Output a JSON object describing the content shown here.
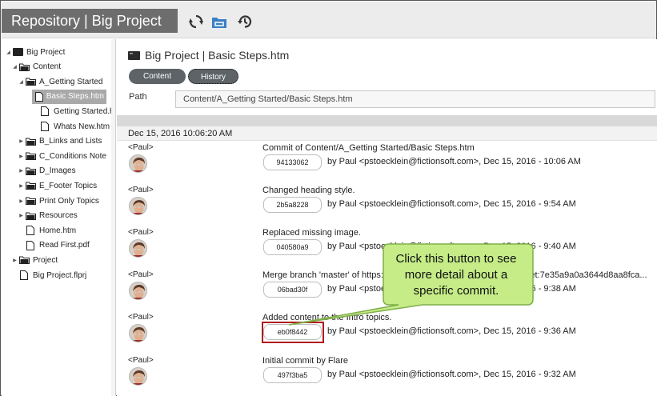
{
  "app": {
    "title": "Repository | Big Project"
  },
  "toolbar": {
    "icons": [
      "sync-icon",
      "folder-icon",
      "history-icon"
    ]
  },
  "sidebar": {
    "items": [
      {
        "label": "Big Project",
        "icon": "project-icon",
        "level": 0,
        "expanded": true
      },
      {
        "label": "Content",
        "icon": "folder-icon",
        "level": 1,
        "expanded": true
      },
      {
        "label": "A_Getting Started",
        "icon": "folder-icon",
        "level": 2,
        "expanded": true
      },
      {
        "label": "Basic Steps.htm",
        "icon": "file-icon",
        "level": 3,
        "selected": true
      },
      {
        "label": "Getting Started.h",
        "icon": "file-icon",
        "level": 3
      },
      {
        "label": "Whats New.htm",
        "icon": "file-icon",
        "level": 3
      },
      {
        "label": "B_Links and Lists",
        "icon": "folder-icon",
        "level": 2,
        "expanded": false
      },
      {
        "label": "C_Conditions Note",
        "icon": "folder-icon",
        "level": 2,
        "expanded": false
      },
      {
        "label": "D_Images",
        "icon": "folder-icon",
        "level": 2,
        "expanded": false
      },
      {
        "label": "E_Footer Topics",
        "icon": "folder-icon",
        "level": 2,
        "expanded": false
      },
      {
        "label": "Print Only Topics",
        "icon": "folder-icon",
        "level": 2,
        "expanded": false
      },
      {
        "label": "Resources",
        "icon": "folder-icon",
        "level": 2,
        "expanded": false
      },
      {
        "label": "Home.htm",
        "icon": "file-icon",
        "level": 2
      },
      {
        "label": "Read First.pdf",
        "icon": "file-icon",
        "level": 2
      },
      {
        "label": "Project",
        "icon": "folder-icon",
        "level": 1,
        "expanded": false
      },
      {
        "label": "Big Project.flprj",
        "icon": "file-icon",
        "level": 1
      }
    ]
  },
  "doc": {
    "header": "Big Project | Basic Steps.htm",
    "tabs": [
      {
        "label": "Content",
        "active": false
      },
      {
        "label": "History",
        "active": true
      }
    ],
    "path_label": "Path",
    "path_value": "Content/A_Getting Started/Basic Steps.htm"
  },
  "history": {
    "date": "Dec 15, 2016 10:06:20 AM",
    "commits": [
      {
        "user": "<Paul>",
        "message": "Commit of Content/A_Getting Started/Basic Steps.htm",
        "hash": "94133062",
        "author": "by Paul <pstoecklein@fictionsoft.com>, Dec 15, 2016 - 10:06 AM"
      },
      {
        "user": "<Paul>",
        "message": "Changed heading style.",
        "hash": "2b5a8228",
        "author": "by Paul <pstoecklein@fictionsoft.com>, Dec 15, 2016 - 9:54 AM"
      },
      {
        "user": "<Paul>",
        "message": "Replaced missing image.",
        "hash": "040580a9",
        "author": "by Paul <pstoecklein@fictionsoft.com>, Dec 15, 2016 - 9:40 AM"
      },
      {
        "user": "<Paul>",
        "message": "Merge branch 'master' of https://fictionsoft.com/bigproject.git into 8c0et:7e35a9a0a3644d8aa8fca...",
        "hash": "06bad30f",
        "author": "by Paul <pstoecklein@fictionsoft.com>, Dec 15, 2016 - 9:38 AM"
      },
      {
        "user": "<Paul>",
        "message": "Added content to the Intro topics.",
        "hash": "eb0f8442",
        "author": "by Paul <pstoecklein@fictionsoft.com>, Dec 15, 2016 - 9:36 AM"
      },
      {
        "user": "<Paul>",
        "message": "Initial commit by Flare",
        "hash": "497f3ba5",
        "author": "by Paul <pstoecklein@fictionsoft.com>, Dec 15, 2016 - 9:32 AM"
      }
    ]
  },
  "callout": {
    "text": "Click this button to see more detail about a specific commit.",
    "fill": "#c5ec87",
    "stroke": "#7fae4a"
  },
  "colors": {
    "title_bg": "#6d6d6d",
    "selected_bg": "#a9a9a9",
    "tab_bg": "#5d6367",
    "highlight": "#b01a1a",
    "accent_blue": "#3a7fc4"
  }
}
